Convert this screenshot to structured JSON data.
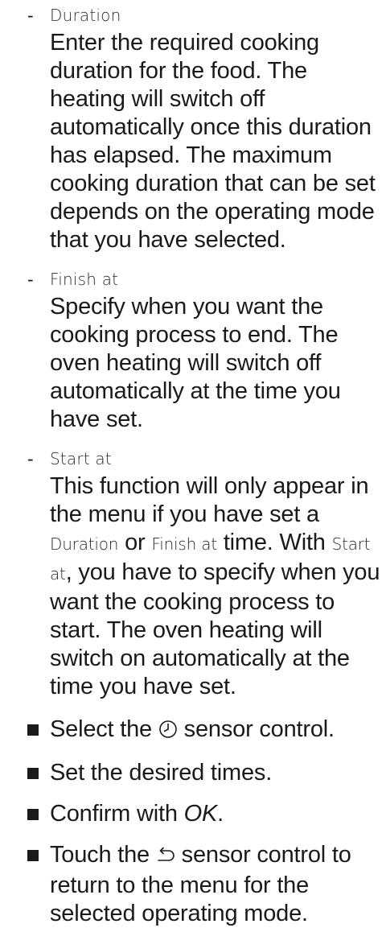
{
  "items": [
    {
      "dash": "-",
      "term": "Duration",
      "description": "Enter the required cooking duration for the food. The heating will switch off automatically once this duration has elapsed. The maximum cooking duration that can be set depends on the operating mode that you have selected."
    },
    {
      "dash": "-",
      "term": "Finish at",
      "description": "Specify when you want the cooking process to end. The oven heating will switch off automatically at the time you have set."
    },
    {
      "dash": "-",
      "term": "Start at",
      "description_parts": {
        "p1": "This function will only appear in the menu if you have set a ",
        "t1": "Duration",
        "p2": " or ",
        "t2": "Finish at",
        "p3": " time. With ",
        "t3": "Start at",
        "p4": ", you have to specify when you want the cooking process to start. The oven heating will switch on automatically at the time you have set."
      }
    }
  ],
  "steps": {
    "s1_before": "Select the ",
    "s1_icon": "clock-icon",
    "s1_after": " sensor control.",
    "s2": "Set the desired times.",
    "s3_before": "Confirm with ",
    "s3_ok": "OK",
    "s3_after": ".",
    "s4_before": "Touch the ",
    "s4_icon": "back-arrow-icon",
    "s4_after": " sensor control to return to the menu for the selected operating mode."
  }
}
